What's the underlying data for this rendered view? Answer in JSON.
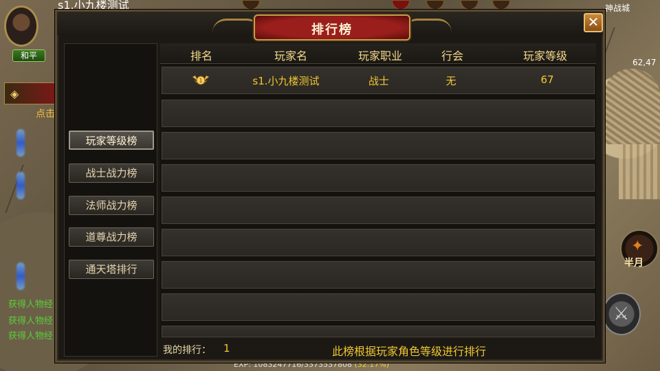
{
  "hud": {
    "player_name": "s1.小九楼测试",
    "pk_mode": "和平",
    "map_name": "神战城",
    "coords": "62,47",
    "skill_label": "半月",
    "left_text_1": "点击",
    "left_status": [
      "获得人物经",
      "获得人物经",
      "获得人物经"
    ],
    "exp_text": "EXP: 1083247716/3373537808",
    "exp_pct": "(32.17%)"
  },
  "panel": {
    "title": "排行榜",
    "close_label": "✕",
    "tabs": [
      {
        "label": "玩家等级榜",
        "active": true
      },
      {
        "label": "战士战力榜",
        "active": false
      },
      {
        "label": "法师战力榜",
        "active": false
      },
      {
        "label": "道尊战力榜",
        "active": false
      },
      {
        "label": "通天塔排行",
        "active": false
      }
    ],
    "columns": [
      "排名",
      "玩家名",
      "玩家职业",
      "行会",
      "玩家等级"
    ],
    "rows": [
      {
        "rank": 1,
        "name": "s1.小九楼测试",
        "class": "战士",
        "guild": "无",
        "level": "67"
      }
    ],
    "footer": {
      "my_rank_label": "我的排行：",
      "my_rank_value": "1",
      "note": "此榜根据玩家角色等级进行排行"
    }
  },
  "colors": {
    "gold_text": "#f0c830",
    "header_text": "#f3d88a",
    "title_plate": "#9a1f1c"
  }
}
